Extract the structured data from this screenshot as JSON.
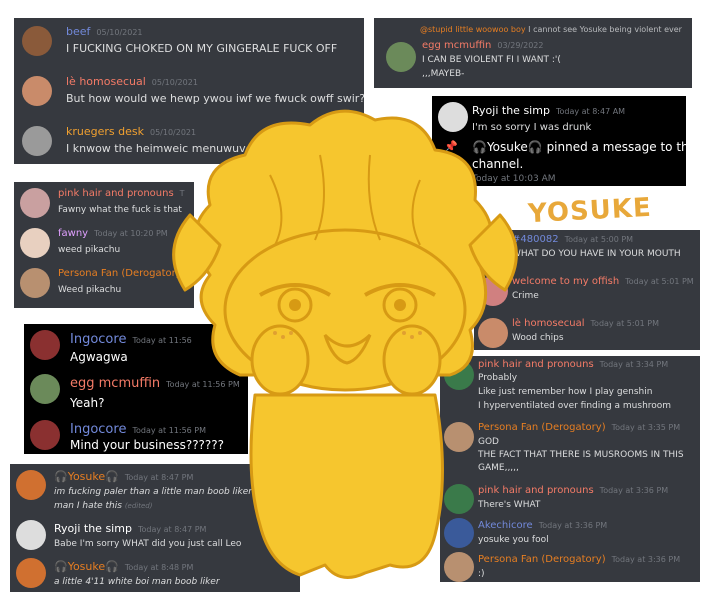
{
  "colors": {
    "discord_bg": "#36393f",
    "discord_dark": "#2f3136",
    "black_panel": "#000000",
    "text": "#dcddde",
    "timestamp": "#72767d",
    "mascot_yellow": "#f6c62e",
    "mascot_outline": "#d79a14"
  },
  "mascot_label": "YOSUKE",
  "panel1": {
    "msgs": [
      {
        "name": "beef",
        "time": "05/10/2021",
        "text": "I FUCKING CHOKED ON MY GINGERALE FUCK OFF"
      },
      {
        "name": "lè homosecual",
        "time": "05/10/2021",
        "text": "But how would we hewp ywou iwf we fwuck owff swir?"
      },
      {
        "name": "kruegers desk",
        "time": "05/10/2021",
        "text": "I knwow the heimweic menuwuver"
      }
    ]
  },
  "panel2": {
    "reply_name": "@stupid little woowoo boy",
    "reply_text": "I cannot see Yosuke being violent ever",
    "name": "egg mcmuffin",
    "time": "03/29/2022",
    "line1": "I CAN BE VIOLENT FI I WANT :'(",
    "line2": ",,,MAYEB-"
  },
  "panel3": {
    "name": "Ryoji the simp",
    "time": "Today at 8:47 AM",
    "text": "I'm so sorry I was drunk",
    "system_name": "🎧Yosuke🎧",
    "system_text1": "pinned a message to this",
    "system_text2": "channel.",
    "system_time": "Today at 10:03 AM"
  },
  "panel4": {
    "msgs": [
      {
        "name": "pink hair and pronouns",
        "time": "T",
        "text": "Fawny what the fuck is that"
      },
      {
        "name": "fawny",
        "time": "Today at 10:20 PM",
        "text": "weed pikachu"
      },
      {
        "name": "Persona Fan (Derogatory)",
        "time": "",
        "text": "Weed pikachu"
      }
    ]
  },
  "panel5": {
    "msgs": [
      {
        "name": "#480082",
        "time": "Today at 5:00 PM",
        "text": "WHAT DO YOU HAVE IN YOUR MOUTH"
      },
      {
        "name": "welcome to my offish",
        "time": "Today at 5:01 PM",
        "text": "Crime"
      },
      {
        "name": "lè homosecual",
        "time": "Today at 5:01 PM",
        "text": "Wood chips"
      }
    ]
  },
  "panel6": {
    "msgs": [
      {
        "name": "Ingocore",
        "time": "Today at 11:56",
        "text": "Agwagwa"
      },
      {
        "name": "egg mcmuffin",
        "time": "Today at 11:56 PM",
        "text": "Yeah?"
      },
      {
        "name": "Ingocore",
        "time": "Today at 11:56 PM",
        "text": "Mind your business??????"
      }
    ]
  },
  "panel7": {
    "m1_name": "pink hair and pronouns",
    "m1_time": "Today at 3:34 PM",
    "m1_lines": [
      "Probably",
      "Like just remember how I play genshin",
      "I hyperventilated over finding a mushroom"
    ],
    "m2_name": "Persona Fan (Derogatory)",
    "m2_time": "Today at 3:35 PM",
    "m2_lines": [
      "GOD",
      "THE FACT THAT THERE IS MUSROOMS IN THIS",
      "GAME,,,,,"
    ],
    "m3_name": "pink hair and pronouns",
    "m3_time": "Today at 3:36 PM",
    "m3_text": "There's WHAT",
    "m4_name": "Akechicore",
    "m4_time": "Today at 3:36 PM",
    "m4_text": "yosuke you fool",
    "m5_name": "Persona Fan (Derogatory)",
    "m5_time": "Today at 3:36 PM",
    "m5_text": ":)"
  },
  "panel8": {
    "m1_name": "🎧Yosuke🎧",
    "m1_time": "Today at 8:47 PM",
    "m1_line1": "im fucking paler than a little man boob liker 4'11 white",
    "m1_line2": "man I hate this",
    "m1_edited": "(edited)",
    "m2_name": "Ryoji the simp",
    "m2_time": "Today at 8:47 PM",
    "m2_text": "Babe I'm sorry WHAT did you just call Leo",
    "m3_name": "🎧Yosuke🎧",
    "m3_time": "Today at 8:48 PM",
    "m3_text": "a little 4'11 white boi man boob liker"
  }
}
